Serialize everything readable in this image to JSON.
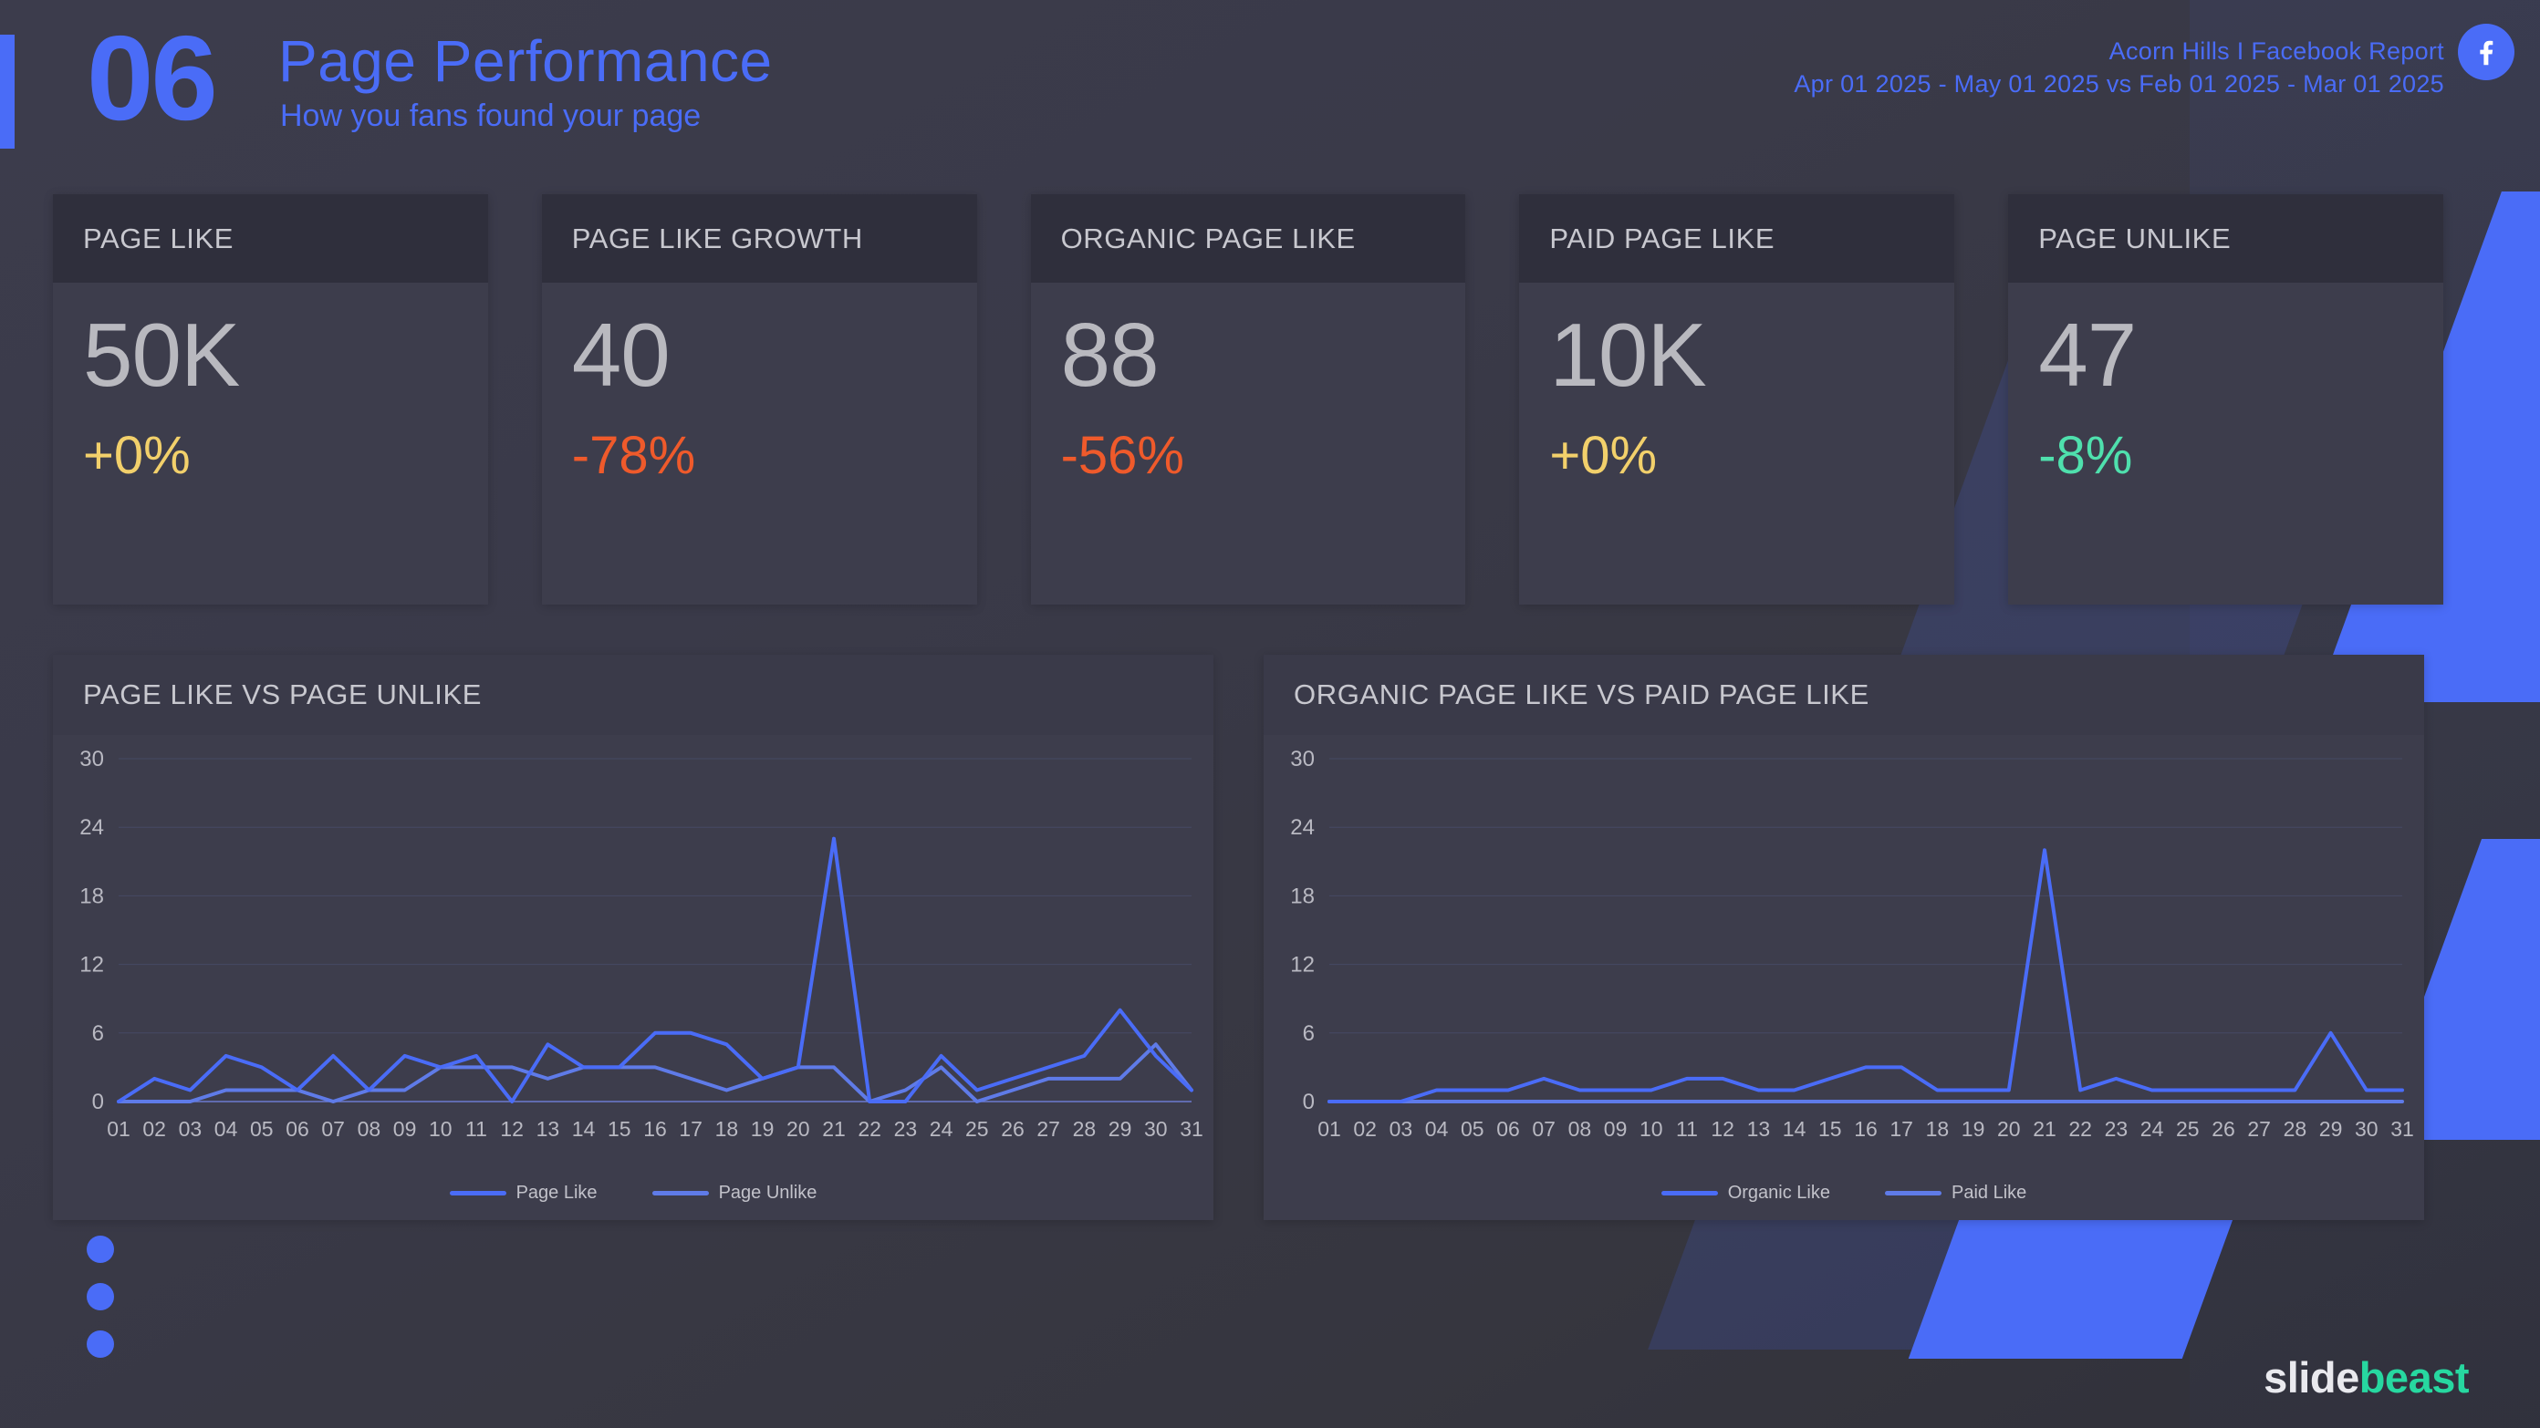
{
  "header": {
    "number": "06",
    "title": "Page Performance",
    "subtitle": "How you fans found your page",
    "account_line": "Acorn Hills  I Facebook Report",
    "date_range": "Apr 01 2025 - May 01 2025 vs Feb 01 2025 - Mar 01 2025",
    "platform_icon": "facebook-icon"
  },
  "kpis": [
    {
      "label": "PAGE LIKE",
      "value": "50K",
      "delta": "+0%",
      "delta_color": "#f2d06b"
    },
    {
      "label": "PAGE LIKE GROWTH",
      "value": "40",
      "delta": "-78%",
      "delta_color": "#ef5a2b"
    },
    {
      "label": "ORGANIC PAGE LIKE",
      "value": "88",
      "delta": "-56%",
      "delta_color": "#ef5a2b"
    },
    {
      "label": "PAID PAGE LIKE",
      "value": "10K",
      "delta": "+0%",
      "delta_color": "#f2d06b"
    },
    {
      "label": "PAGE UNLIKE",
      "value": "47",
      "delta": "-8%",
      "delta_color": "#4fe0ad"
    }
  ],
  "footer": {
    "logo_part_1": "slide",
    "logo_part_2": "beast"
  },
  "theme": {
    "accent": "#4a6cf7",
    "series_a": "#4a6cf7",
    "series_b": "#5f7be8",
    "card_bg": "#3d3d4c",
    "card_head_bg": "#2f2f3c",
    "value_text": "#b9b9bf"
  },
  "chart_data": [
    {
      "type": "line",
      "title": "PAGE LIKE VS PAGE UNLIKE",
      "xlabel": "",
      "ylabel": "",
      "ylim": [
        0,
        30
      ],
      "yticks": [
        0,
        6,
        12,
        18,
        24,
        30
      ],
      "grid": true,
      "legend_position": "bottom",
      "categories": [
        "01",
        "02",
        "03",
        "04",
        "05",
        "06",
        "07",
        "08",
        "09",
        "10",
        "11",
        "12",
        "13",
        "14",
        "15",
        "16",
        "17",
        "18",
        "19",
        "20",
        "21",
        "22",
        "23",
        "24",
        "25",
        "26",
        "27",
        "28",
        "29",
        "30",
        "31"
      ],
      "series": [
        {
          "name": "Page Like",
          "color": "#4a6cf7",
          "values": [
            0,
            2,
            1,
            4,
            3,
            1,
            4,
            1,
            4,
            3,
            4,
            0,
            5,
            3,
            3,
            6,
            6,
            5,
            2,
            3,
            23,
            0,
            0,
            4,
            1,
            2,
            3,
            4,
            8,
            4,
            1
          ]
        },
        {
          "name": "Page Unlike",
          "color": "#5f7be8",
          "values": [
            0,
            0,
            0,
            1,
            1,
            1,
            0,
            1,
            1,
            3,
            3,
            3,
            2,
            3,
            3,
            3,
            2,
            1,
            2,
            3,
            3,
            0,
            1,
            3,
            0,
            1,
            2,
            2,
            2,
            5,
            1
          ]
        }
      ]
    },
    {
      "type": "line",
      "title": "ORGANIC PAGE LIKE VS PAID PAGE LIKE",
      "xlabel": "",
      "ylabel": "",
      "ylim": [
        0,
        30
      ],
      "yticks": [
        0,
        6,
        12,
        18,
        24,
        30
      ],
      "grid": true,
      "legend_position": "bottom",
      "categories": [
        "01",
        "02",
        "03",
        "04",
        "05",
        "06",
        "07",
        "08",
        "09",
        "10",
        "11",
        "12",
        "13",
        "14",
        "15",
        "16",
        "17",
        "18",
        "19",
        "20",
        "21",
        "22",
        "23",
        "24",
        "25",
        "26",
        "27",
        "28",
        "29",
        "30",
        "31"
      ],
      "series": [
        {
          "name": "Organic Like",
          "color": "#4a6cf7",
          "values": [
            0,
            0,
            0,
            1,
            1,
            1,
            2,
            1,
            1,
            1,
            2,
            2,
            1,
            1,
            2,
            3,
            3,
            1,
            1,
            1,
            22,
            1,
            2,
            1,
            1,
            1,
            1,
            1,
            6,
            1,
            1
          ]
        },
        {
          "name": "Paid Like",
          "color": "#5f7be8",
          "values": [
            0,
            0,
            0,
            0,
            0,
            0,
            0,
            0,
            0,
            0,
            0,
            0,
            0,
            0,
            0,
            0,
            0,
            0,
            0,
            0,
            0,
            0,
            0,
            0,
            0,
            0,
            0,
            0,
            0,
            0,
            0
          ]
        }
      ]
    }
  ]
}
